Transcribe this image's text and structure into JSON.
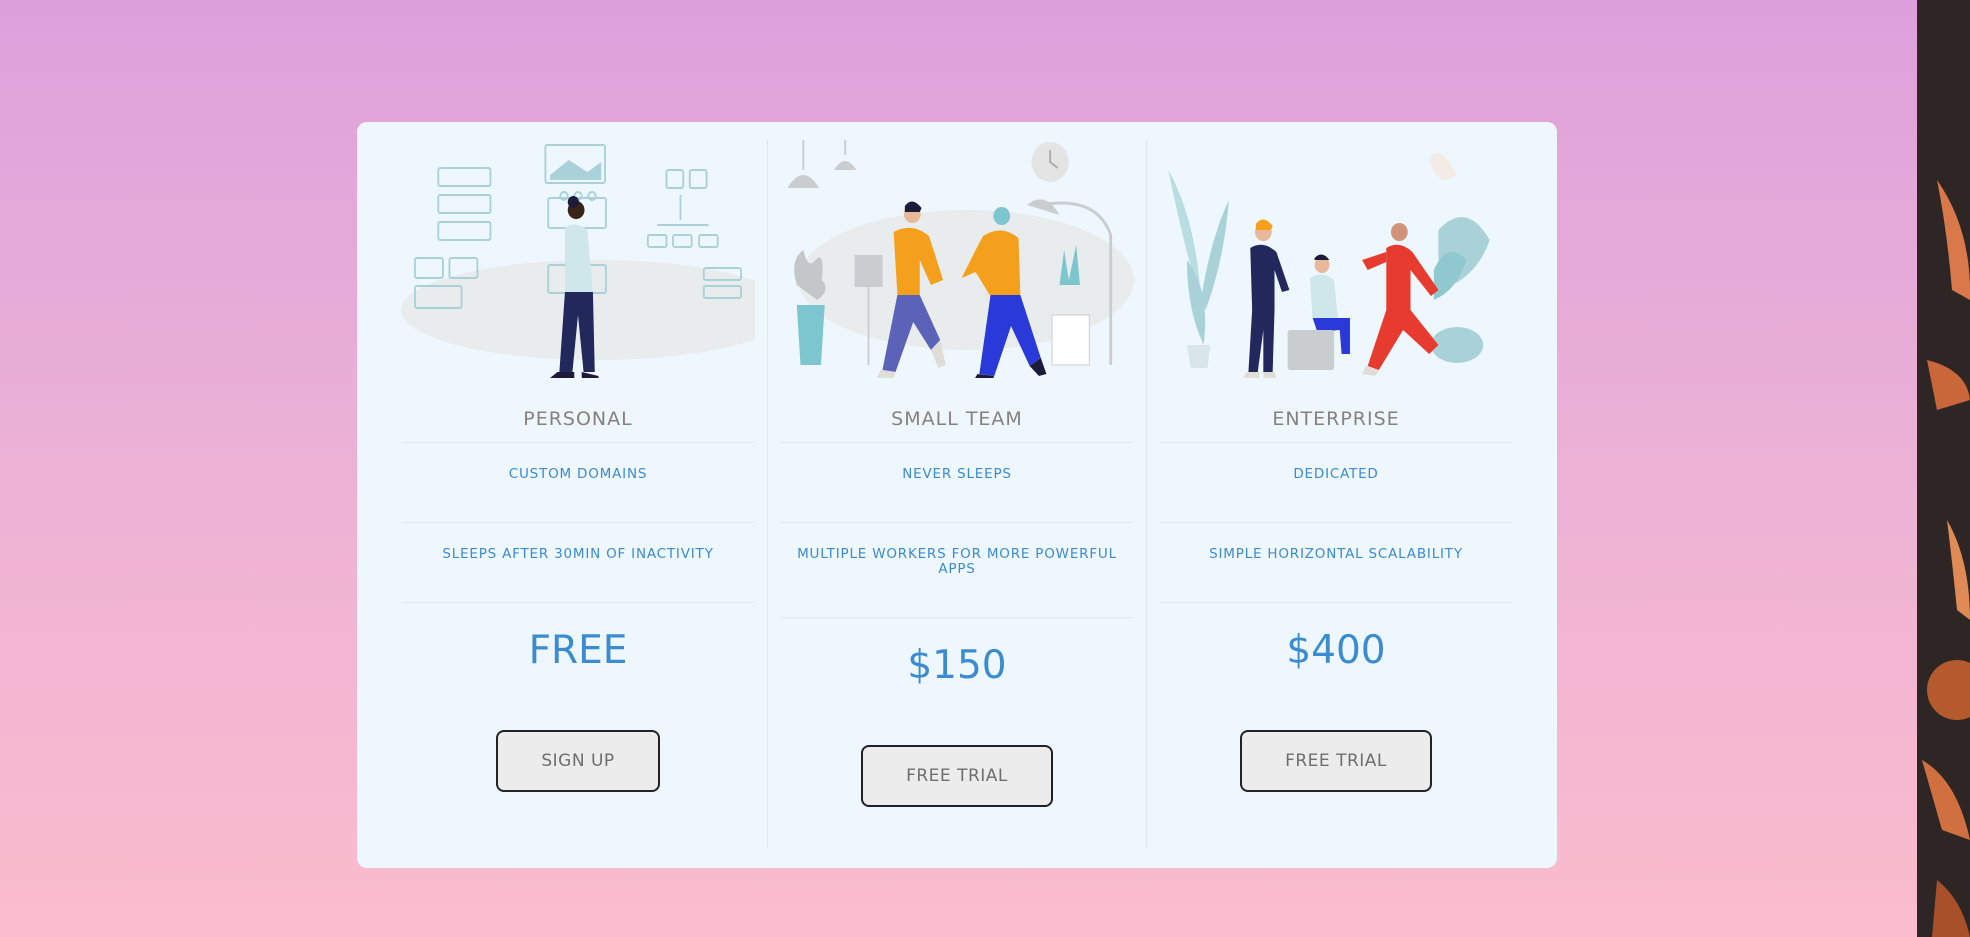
{
  "plans": [
    {
      "title": "PERSONAL",
      "features": [
        "CUSTOM DOMAINS",
        "SLEEPS AFTER 30MIN OF INACTIVITY"
      ],
      "price": "FREE",
      "cta": "SIGN UP"
    },
    {
      "title": "SMALL TEAM",
      "features": [
        "NEVER SLEEPS",
        "MULTIPLE WORKERS FOR MORE POWERFUL APPS"
      ],
      "price": "$150",
      "cta": "FREE TRIAL"
    },
    {
      "title": "ENTERPRISE",
      "features": [
        "DEDICATED",
        "SIMPLE HORIZONTAL SCALABILITY"
      ],
      "price": "$400",
      "cta": "FREE TRIAL"
    }
  ],
  "colors": {
    "accent": "#3b8bd1",
    "title": "#86817c",
    "card_bg": "#eef7fd",
    "bg_top": "#dda0dc",
    "bg_bottom": "#fbbccd"
  },
  "illustrations": [
    "person-walking-wireframes-illustration",
    "two-people-high-five-illustration",
    "team-meeting-illustration"
  ]
}
